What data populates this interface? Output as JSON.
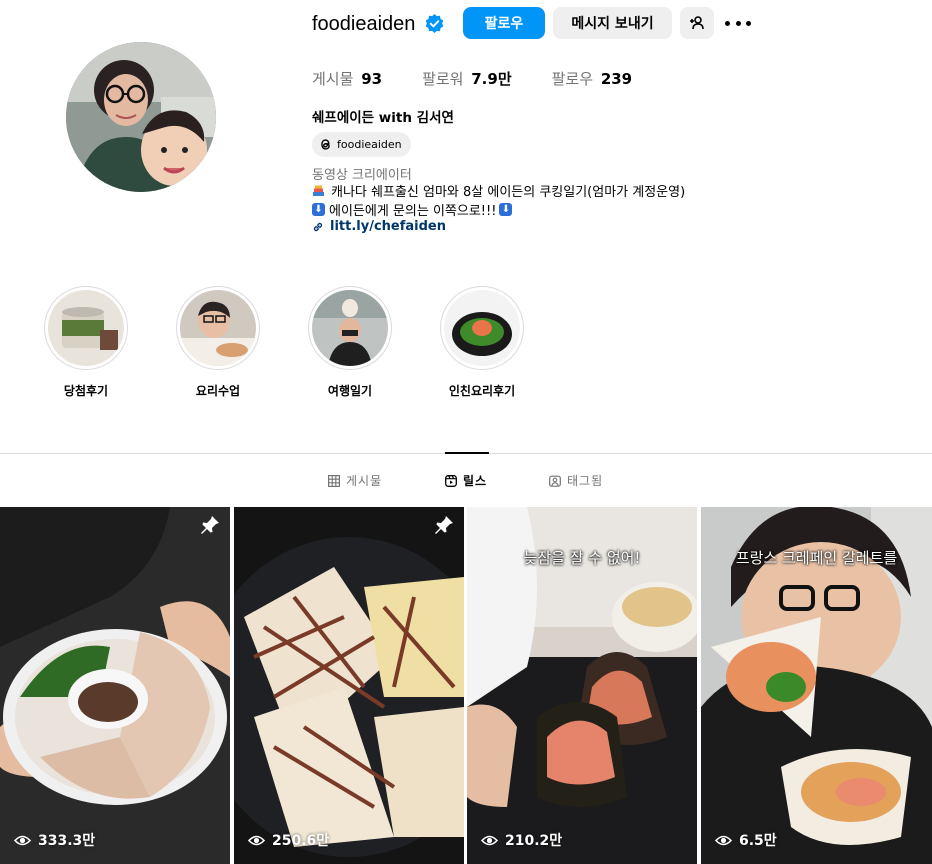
{
  "profile": {
    "username": "foodieaiden",
    "follow_label": "팔로우",
    "message_label": "메시지 보내기",
    "stats": {
      "posts_label": "게시물",
      "posts_value": "93",
      "followers_label": "팔로워",
      "followers_value": "7.9만",
      "following_label": "팔로우",
      "following_value": "239"
    },
    "full_name": "쉐프에이든 with 김서연",
    "threads_handle": "foodieaiden",
    "category": "동영상 크리에이터",
    "bio_line1": "캐나다 쉐프출신 엄마와 8살 에이든의 쿠킹일기(엄마가 계정운영)",
    "bio_line2_arrow": "⬇",
    "bio_line2": "에이든에게 문의는 이쪽으로!!!",
    "link": "litt.ly/chefaiden"
  },
  "highlights": [
    {
      "label": "당첨후기"
    },
    {
      "label": "요리수업"
    },
    {
      "label": "여행일기"
    },
    {
      "label": "인친요리후기"
    }
  ],
  "tabs": [
    {
      "label": "게시물",
      "active": false
    },
    {
      "label": "릴스",
      "active": true
    },
    {
      "label": "태그됨",
      "active": false
    }
  ],
  "reels": [
    {
      "views": "333.3만",
      "pinned": true,
      "caption": ""
    },
    {
      "views": "250.6만",
      "pinned": true,
      "caption": ""
    },
    {
      "views": "210.2만",
      "pinned": false,
      "caption": "늦잠을 잘 수 없어!"
    },
    {
      "views": "6.5만",
      "pinned": false,
      "caption": "프랑스 크레페인 갈레트를"
    }
  ],
  "colors": {
    "accent": "#0095f6",
    "secondary_button": "#efefef",
    "muted_text": "#737373",
    "link_text": "#00376b",
    "divider": "#dbdbdb"
  }
}
